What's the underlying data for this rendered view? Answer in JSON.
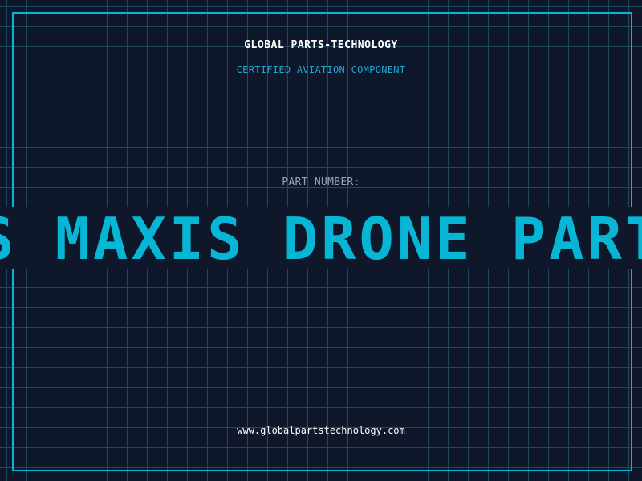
{
  "header": {
    "company": "GLOBAL PARTS-TECHNOLOGY",
    "subtitle": "CERTIFIED AVIATION COMPONENT"
  },
  "part": {
    "label": "PART NUMBER:",
    "value": "S MAXIS DRONE PART"
  },
  "footer": {
    "website": "www.globalpartstechnology.com"
  },
  "colors": {
    "background": "#0f172a",
    "grid": "#1e4a5f",
    "accent": "#06b6d4",
    "text": "#ffffff",
    "muted": "#94a3b8"
  }
}
